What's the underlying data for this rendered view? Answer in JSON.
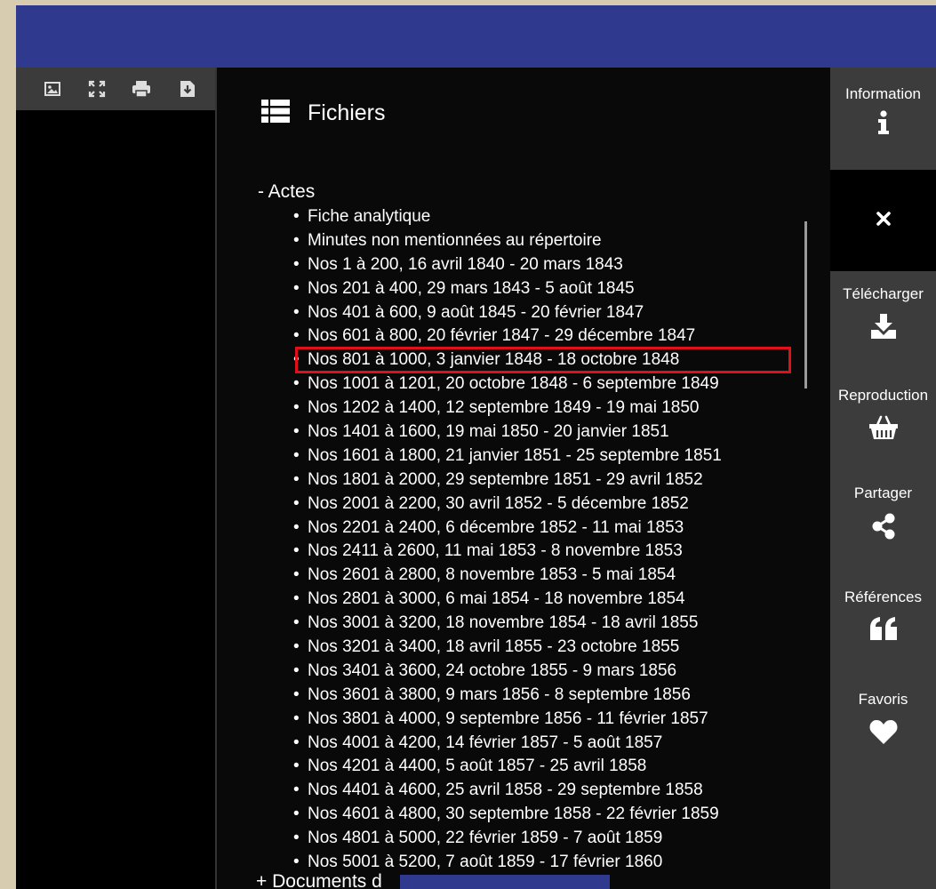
{
  "toolbar": {
    "icons": [
      "image-icon",
      "fullscreen-icon",
      "print-icon",
      "download-icon"
    ]
  },
  "panel": {
    "title": "Fichiers",
    "section_actes": "- Actes",
    "files": [
      "Fiche analytique",
      "Minutes non mentionnées au répertoire",
      "Nos 1 à 200, 16 avril 1840 - 20 mars 1843",
      "Nos 201 à 400, 29 mars 1843 - 5 août 1845",
      "Nos 401 à 600, 9 août 1845 - 20 février 1847",
      "Nos 601 à 800, 20 février 1847 - 29 décembre 1847",
      "Nos 801 à 1000, 3 janvier 1848 - 18 octobre 1848",
      "Nos 1001 à 1201, 20 octobre 1848 - 6 septembre 1849",
      "Nos 1202 à 1400, 12 septembre 1849 - 19 mai 1850",
      "Nos 1401 à 1600, 19 mai 1850 - 20 janvier 1851",
      "Nos 1601 à 1800, 21 janvier 1851 - 25 septembre 1851",
      "Nos 1801 à 2000, 29 septembre 1851 - 29 avril 1852",
      "Nos 2001 à 2200, 30 avril 1852 - 5 décembre 1852",
      "Nos 2201 à 2400, 6 décembre 1852 - 11 mai 1853",
      "Nos 2411 à 2600, 11 mai 1853 - 8 novembre 1853",
      "Nos 2601 à 2800, 8 novembre 1853 - 5 mai 1854",
      "Nos 2801 à 3000, 6 mai 1854 - 18 novembre 1854",
      "Nos 3001 à 3200, 18 novembre 1854 - 18 avril 1855",
      "Nos 3201 à 3400, 18 avril 1855 - 23 octobre 1855",
      "Nos 3401 à 3600, 24 octobre 1855 - 9 mars 1856",
      "Nos 3601 à 3800, 9 mars 1856 - 8 septembre 1856",
      "Nos 3801 à 4000, 9 septembre 1856 - 11 février 1857",
      "Nos 4001 à 4200, 14 février 1857 - 5 août 1857",
      "Nos 4201 à 4400, 5 août 1857 - 25 avril 1858",
      "Nos 4401 à 4600, 25 avril 1858 - 29 septembre 1858",
      "Nos 4601 à 4800, 30 septembre 1858 - 22 février 1859",
      "Nos 4801 à 5000, 22 février 1859 - 7 août 1859",
      "Nos 5001 à 5200, 7 août 1859 - 17 février 1860"
    ],
    "selected_index": 6,
    "section_documents": "+ Documents d"
  },
  "sidebar": {
    "information": "Information",
    "close": "×",
    "download": "Télécharger",
    "reproduction": "Reproduction",
    "share": "Partager",
    "references": "Références",
    "favorites": "Favoris"
  },
  "colors": {
    "topbar": "#2f3a8f",
    "highlight": "#e0101a",
    "sidebar_bg": "#3c3c3c"
  }
}
